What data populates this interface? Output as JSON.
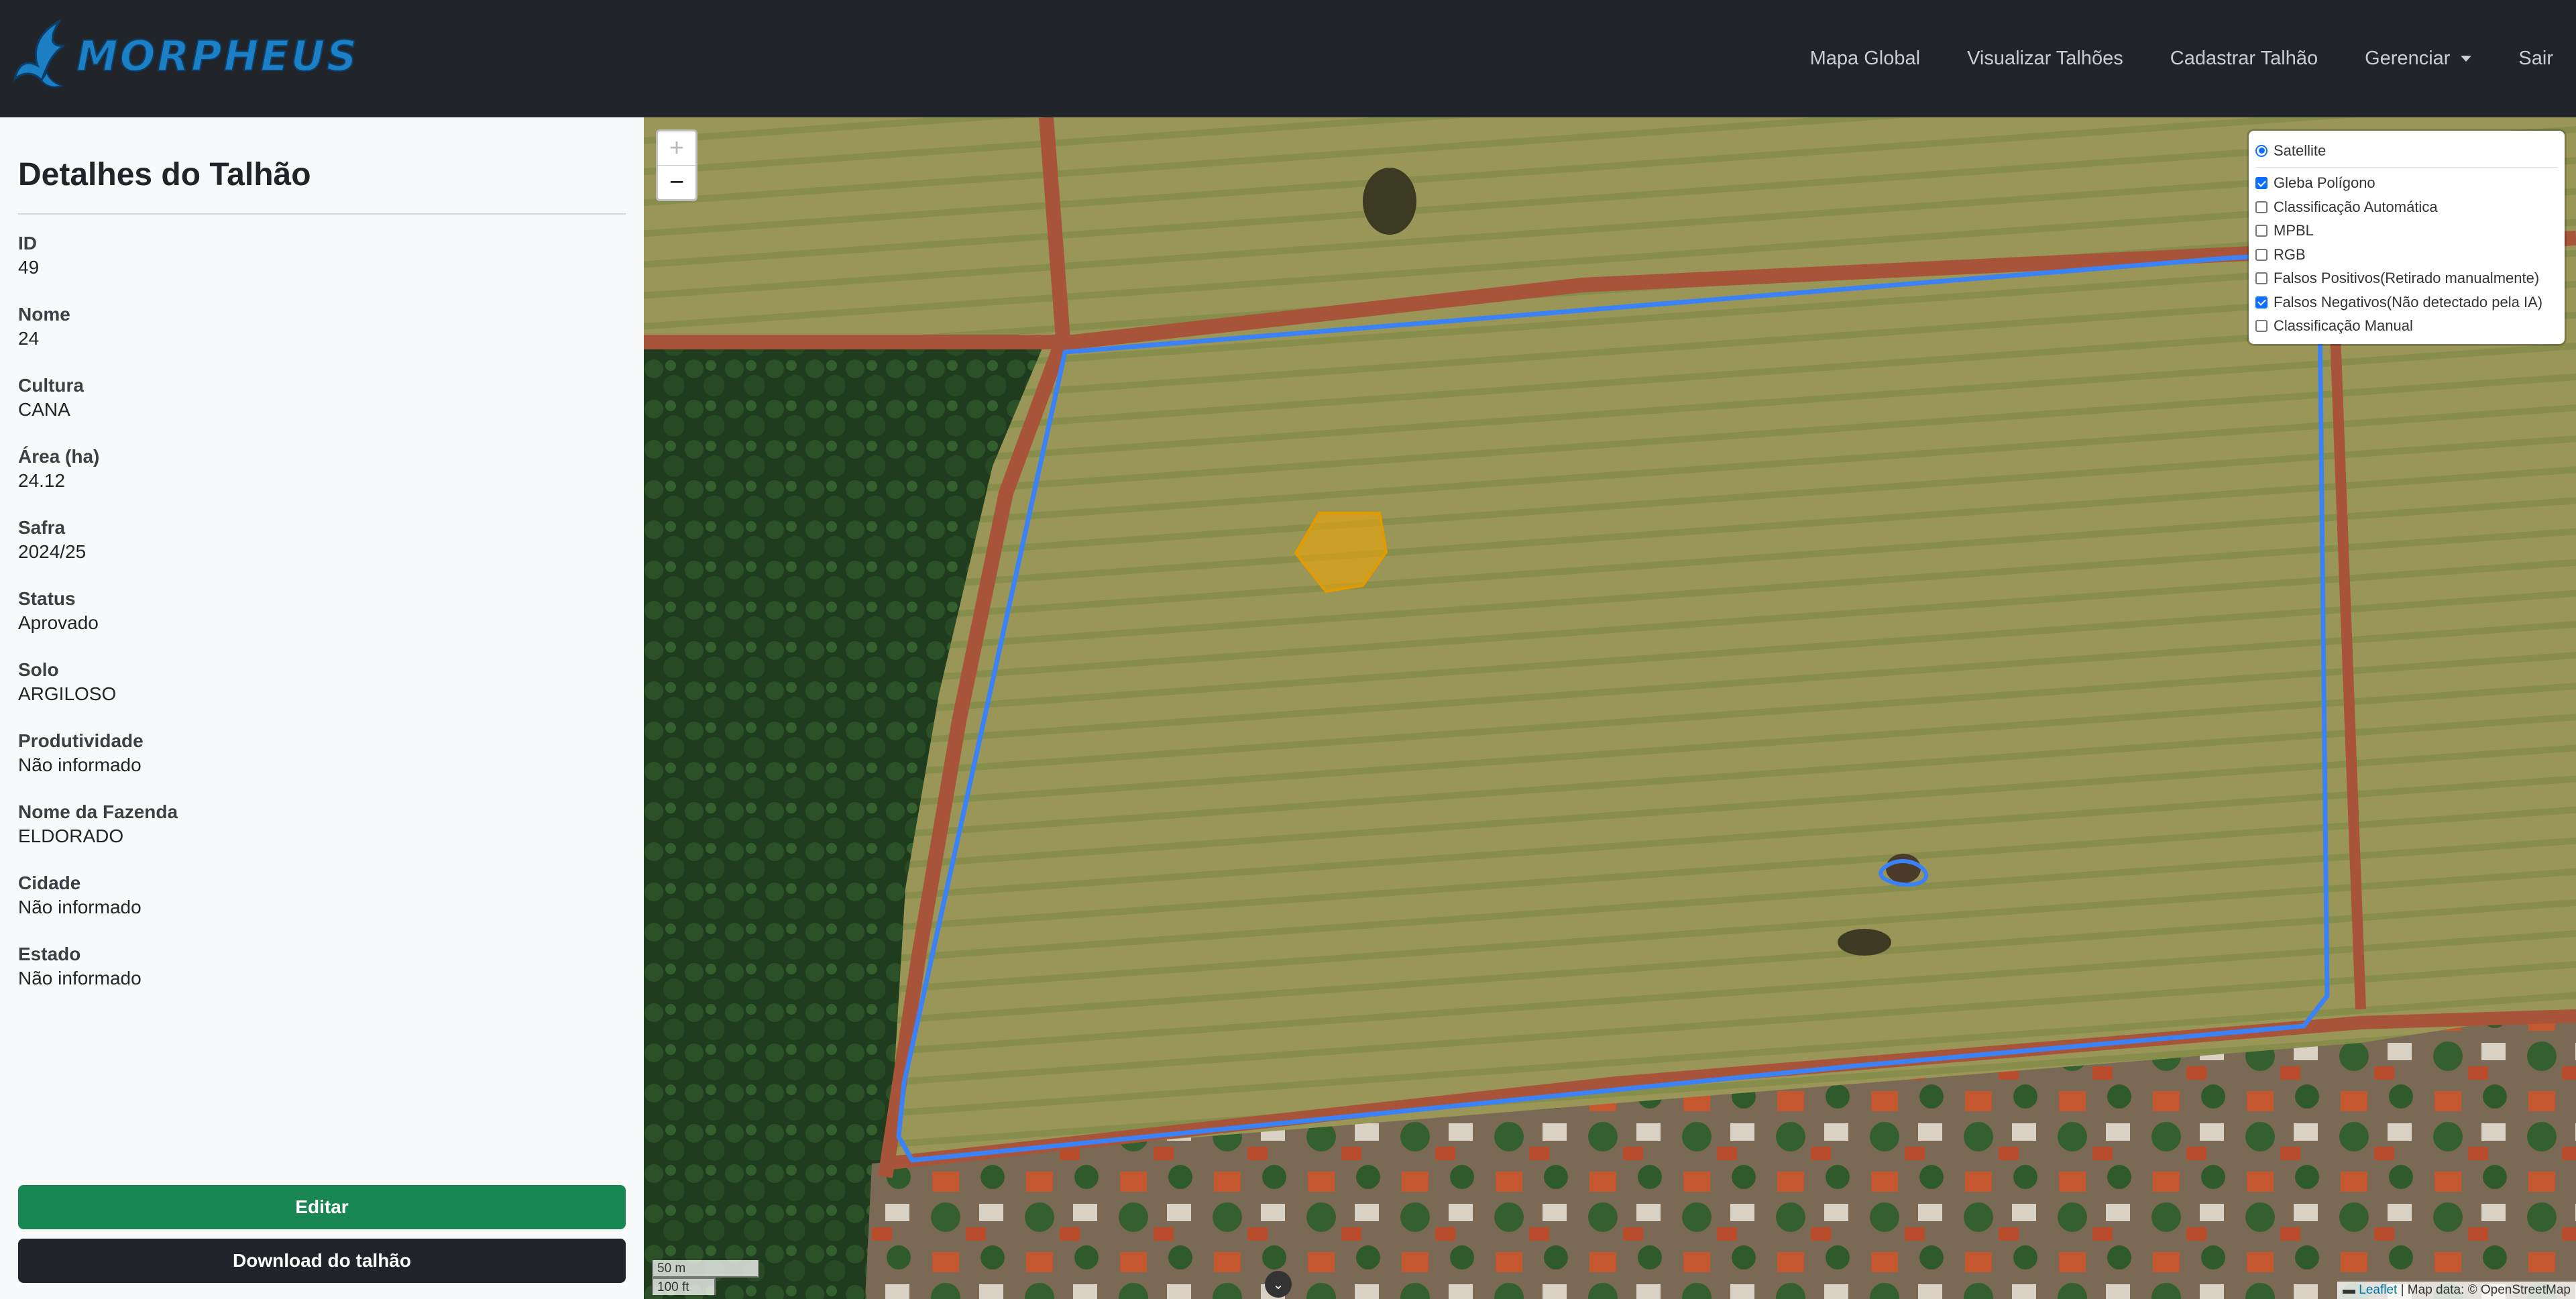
{
  "brand": {
    "logo_text": "MORPHEUS",
    "colors": {
      "primary": "#1d7fc4",
      "navbar": "#212529"
    }
  },
  "nav": {
    "items": [
      {
        "label": "Mapa Global"
      },
      {
        "label": "Visualizar Talhões"
      },
      {
        "label": "Cadastrar Talhão"
      },
      {
        "label": "Gerenciar"
      },
      {
        "label": "Sair"
      }
    ]
  },
  "sidebar": {
    "title": "Detalhes do Talhão",
    "fields": [
      {
        "label": "ID",
        "value": "49"
      },
      {
        "label": "Nome",
        "value": "24"
      },
      {
        "label": "Cultura",
        "value": "CANA"
      },
      {
        "label": "Área (ha)",
        "value": "24.12"
      },
      {
        "label": "Safra",
        "value": "2024/25"
      },
      {
        "label": "Status",
        "value": "Aprovado"
      },
      {
        "label": "Solo",
        "value": "ARGILOSO"
      },
      {
        "label": "Produtividade",
        "value": "Não informado"
      },
      {
        "label": "Nome da Fazenda",
        "value": "ELDORADO"
      },
      {
        "label": "Cidade",
        "value": "Não informado"
      },
      {
        "label": "Estado",
        "value": "Não informado"
      }
    ],
    "edit_button": "Editar",
    "download_button": "Download do talhão",
    "colors": {
      "edit": "#198754",
      "download": "#212529"
    }
  },
  "map": {
    "zoom_in": "+",
    "zoom_out": "−",
    "base_layer": {
      "label": "Satellite",
      "selected": true
    },
    "overlays": [
      {
        "label": "Gleba Polígono",
        "checked": true
      },
      {
        "label": "Classificação Automática",
        "checked": false
      },
      {
        "label": "MPBL",
        "checked": false
      },
      {
        "label": "RGB",
        "checked": false
      },
      {
        "label": "Falsos Positivos(Retirado manualmente)",
        "checked": false
      },
      {
        "label": "Falsos Negativos(Não detectado pela IA)",
        "checked": true
      },
      {
        "label": "Classificação Manual",
        "checked": false
      }
    ],
    "scale": {
      "metric": "50 m",
      "imperial": "100 ft"
    },
    "attribution": {
      "leaflet": "Leaflet",
      "text": " | Map data: © OpenStreetMap"
    },
    "colors": {
      "boundary": "#3b82f6",
      "false_negative": "#f5a800"
    }
  }
}
